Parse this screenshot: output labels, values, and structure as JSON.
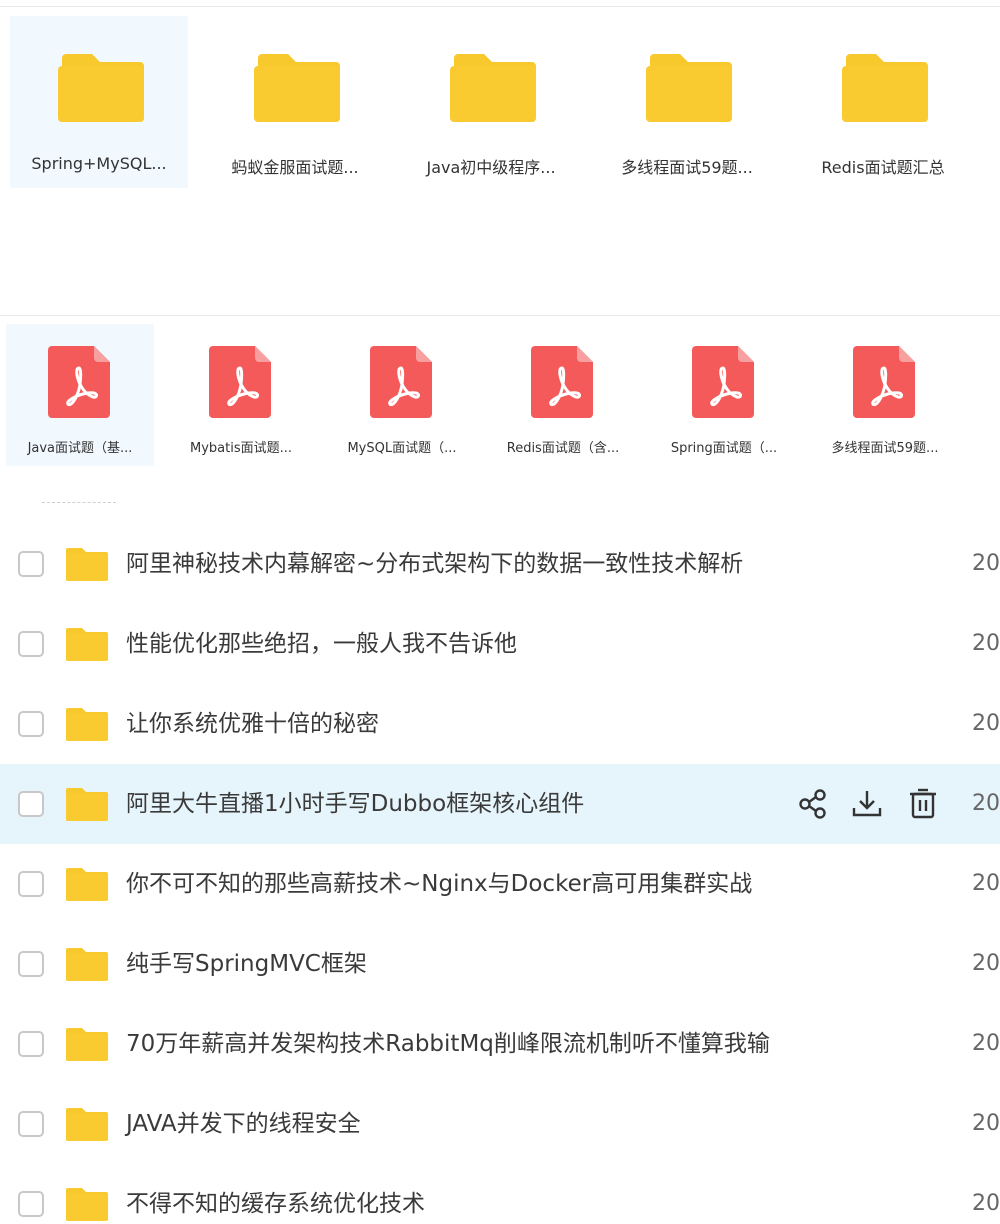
{
  "folders": [
    {
      "label": "Spring+MySQL..."
    },
    {
      "label": "蚂蚁金服面试题..."
    },
    {
      "label": "Java初中级程序..."
    },
    {
      "label": "多线程面试59题..."
    },
    {
      "label": "Redis面试题汇总"
    }
  ],
  "pdfs": [
    {
      "label": "Java面试题（基..."
    },
    {
      "label": "Mybatis面试题..."
    },
    {
      "label": "MySQL面试题（..."
    },
    {
      "label": "Redis面试题（含..."
    },
    {
      "label": "Spring面试题（..."
    },
    {
      "label": "多线程面试59题..."
    }
  ],
  "list": [
    {
      "name": "阿里神秘技术内幕解密~分布式架构下的数据一致性技术解析",
      "date": "20"
    },
    {
      "name": "性能优化那些绝招，一般人我不告诉他",
      "date": "20"
    },
    {
      "name": "让你系统优雅十倍的秘密",
      "date": "20"
    },
    {
      "name": "阿里大牛直播1小时手写Dubbo框架核心组件",
      "date": "20"
    },
    {
      "name": "你不可不知的那些高薪技术~Nginx与Docker高可用集群实战",
      "date": "20"
    },
    {
      "name": "纯手写SpringMVC框架",
      "date": "20"
    },
    {
      "name": "70万年薪高并发架构技术RabbitMq削峰限流机制听不懂算我输",
      "date": "20"
    },
    {
      "name": "JAVA并发下的线程安全",
      "date": "20"
    },
    {
      "name": "不得不知的缓存系统优化技术",
      "date": "20"
    }
  ],
  "hovered_row_actions": [
    "share-icon",
    "download-icon",
    "delete-icon"
  ],
  "colors": {
    "folder": "#f8c92c",
    "pdf": "#f55a5a",
    "hover_row": "#e6f4fb",
    "selected_tile": "#f1f8fe"
  }
}
